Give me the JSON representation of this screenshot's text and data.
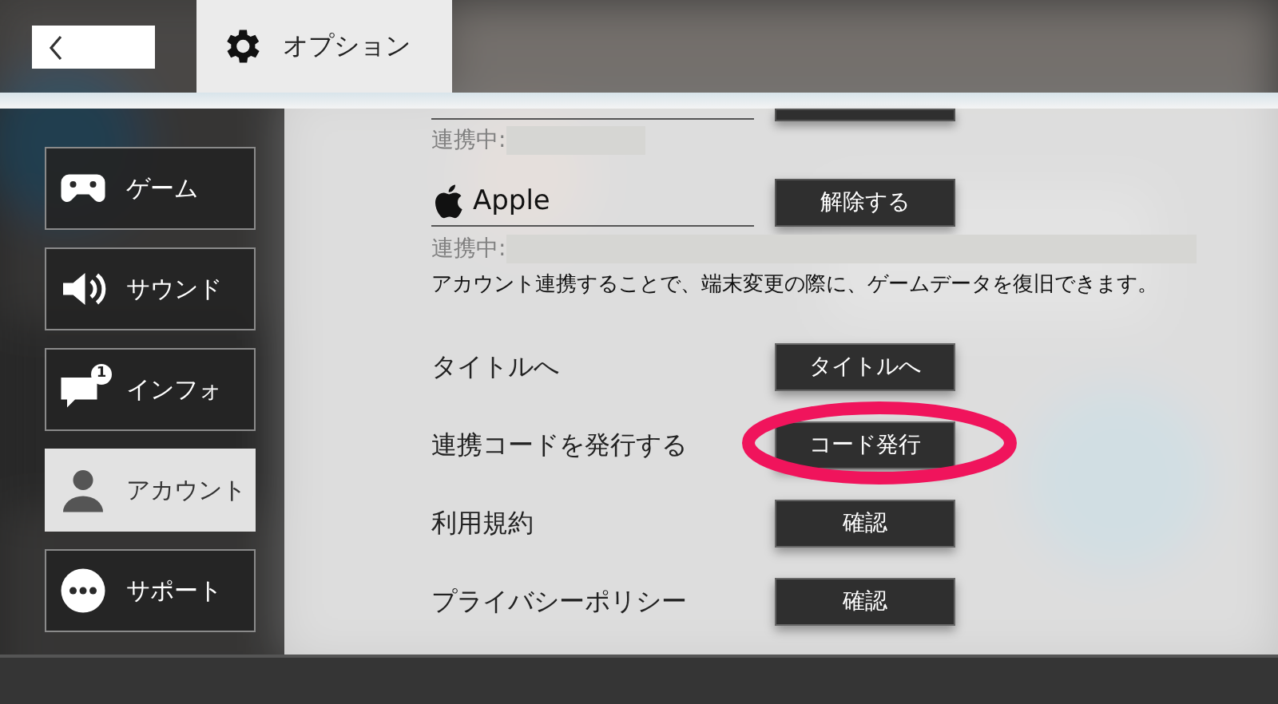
{
  "header": {
    "title": "オプション"
  },
  "sidebar": {
    "items": [
      {
        "label": "ゲーム",
        "selected": false
      },
      {
        "label": "サウンド",
        "selected": false
      },
      {
        "label": "インフォ",
        "selected": false,
        "badge": "1"
      },
      {
        "label": "アカウント",
        "selected": true
      },
      {
        "label": "サポート",
        "selected": false
      }
    ]
  },
  "accounts": [
    {
      "status": "連携中:"
    },
    {
      "name": "Apple",
      "button": "解除する",
      "status": "連携中:"
    }
  ],
  "note": "アカウント連携することで、端末変更の際に、ゲームデータを復旧できます。",
  "rows": [
    {
      "label": "タイトルへ",
      "button": "タイトルへ",
      "highlighted": false
    },
    {
      "label": "連携コードを発行する",
      "button": "コード発行",
      "highlighted": true
    },
    {
      "label": "利用規約",
      "button": "確認",
      "highlighted": false
    },
    {
      "label": "プライバシーポリシー",
      "button": "確認",
      "highlighted": false
    }
  ]
}
